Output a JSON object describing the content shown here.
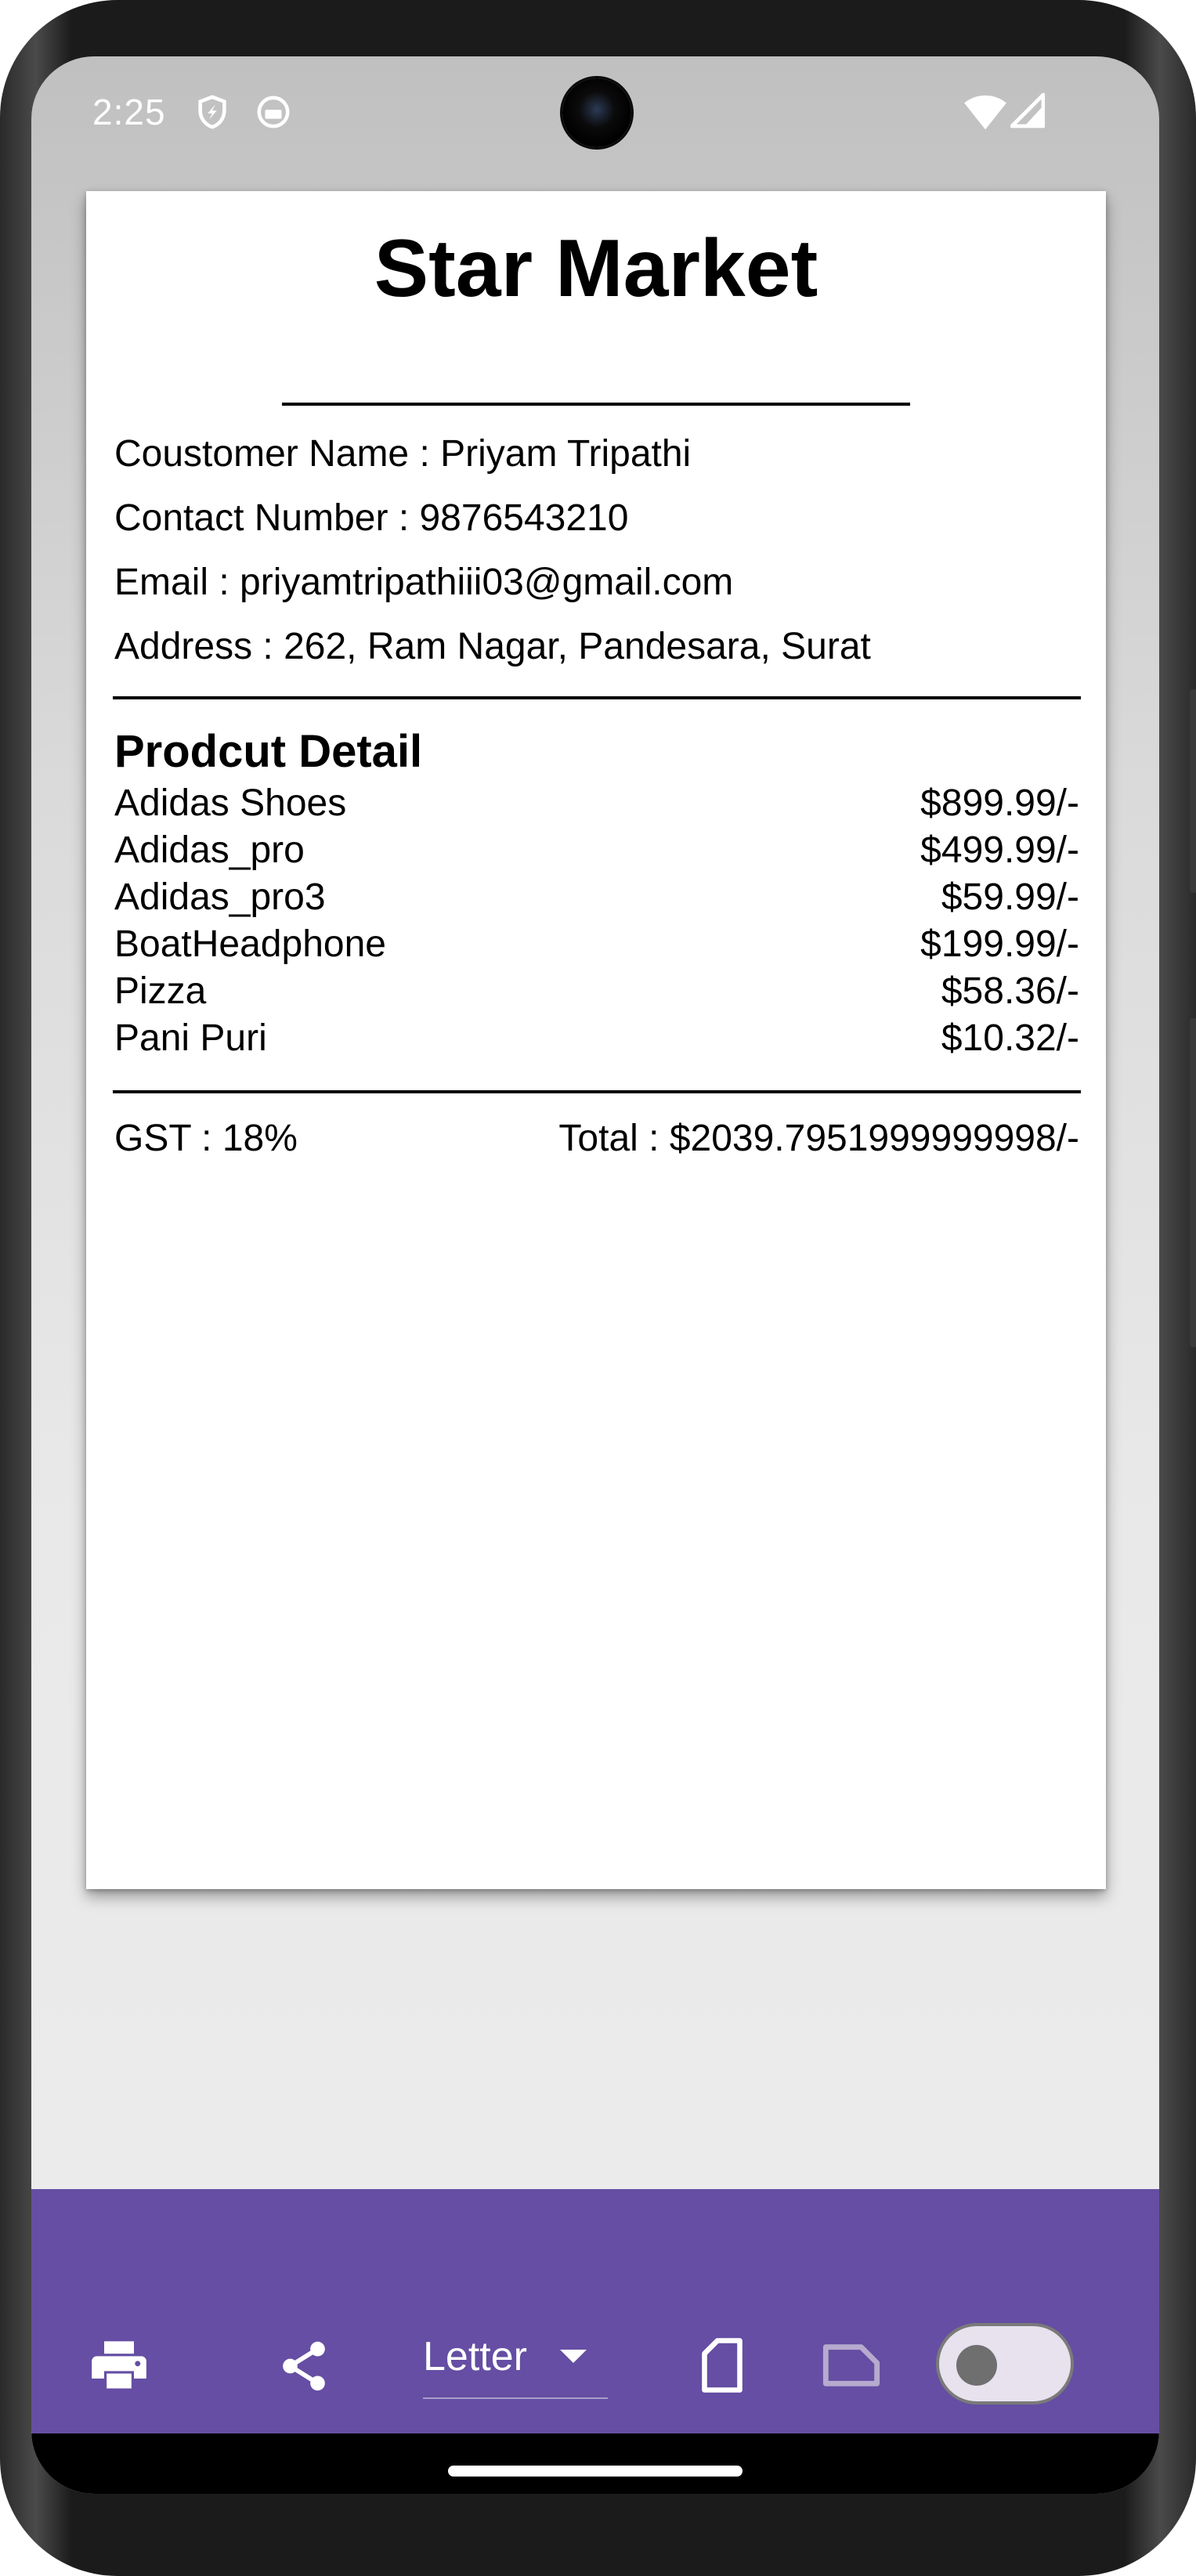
{
  "status_bar": {
    "time": "2:25"
  },
  "receipt": {
    "store_name": "Star Market",
    "customer": "Coustomer Name : Priyam Tripathi",
    "contact": "Contact Number : 9876543210",
    "email": "Email : priyamtripathiii03@gmail.com",
    "address": "Address : 262, Ram Nagar, Pandesara, Surat",
    "section_title": "Prodcut Detail",
    "products": [
      {
        "name": "Adidas Shoes",
        "price": "$899.99/-"
      },
      {
        "name": "Adidas_pro",
        "price": "$499.99/-"
      },
      {
        "name": "Adidas_pro3",
        "price": "$59.99/-"
      },
      {
        "name": "BoatHeadphone",
        "price": "$199.99/-"
      },
      {
        "name": "Pizza",
        "price": "$58.36/-"
      },
      {
        "name": "Pani Puri",
        "price": "$10.32/-"
      }
    ],
    "gst": "GST : 18%",
    "total": "Total : $2039.7951999999998/-"
  },
  "toolbar": {
    "paper_size": "Letter",
    "icons": [
      "print-icon",
      "share-icon",
      "portrait-orientation-icon",
      "landscape-orientation-icon"
    ],
    "toggle_on": false,
    "background_color": "#654ea3"
  }
}
